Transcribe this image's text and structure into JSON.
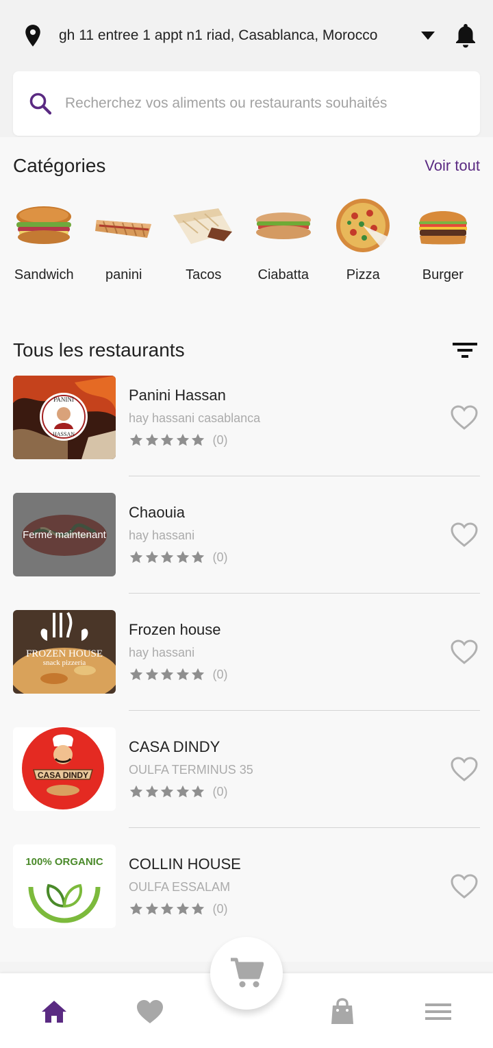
{
  "header": {
    "address": "gh 11 entree 1 appt n1 riad, Casablanca, Morocco"
  },
  "search": {
    "placeholder": "Recherchez vos aliments ou restaurants souhaités"
  },
  "categories_section": {
    "title": "Catégories",
    "see_all": "Voir tout",
    "items": [
      {
        "label": "Sandwich"
      },
      {
        "label": "panini"
      },
      {
        "label": "Tacos"
      },
      {
        "label": "Ciabatta"
      },
      {
        "label": "Pizza"
      },
      {
        "label": "Burger"
      }
    ]
  },
  "restaurants_section": {
    "title": "Tous les restaurants",
    "items": [
      {
        "name": "Panini Hassan",
        "address": "hay hassani casablanca",
        "rating_count": "(0)",
        "logo_text": "PANINI HASSAN"
      },
      {
        "name": "Chaouia",
        "address": "hay hassani",
        "rating_count": "(0)",
        "closed_label": "Fermé maintenant"
      },
      {
        "name": "Frozen house",
        "address": "hay hassani",
        "rating_count": "(0)",
        "logo_text": "FROZEN HOUSE",
        "logo_sub": "snack pizzeria"
      },
      {
        "name": "CASA DINDY",
        "address": "OULFA TERMINUS 35",
        "rating_count": "(0)",
        "logo_text": "CASA DINDY"
      },
      {
        "name": "COLLIN HOUSE",
        "address": "OULFA ESSALAM",
        "rating_count": "(0)",
        "logo_text": "100% ORGANIC"
      }
    ]
  },
  "colors": {
    "accent": "#5a2a82",
    "star": "#8f8f8f",
    "heart": "#b0b0b0"
  },
  "bottom_nav": {
    "items": [
      "home-icon",
      "heart-icon",
      "cart-icon",
      "bag-icon",
      "menu-icon"
    ],
    "active": "home-icon"
  }
}
